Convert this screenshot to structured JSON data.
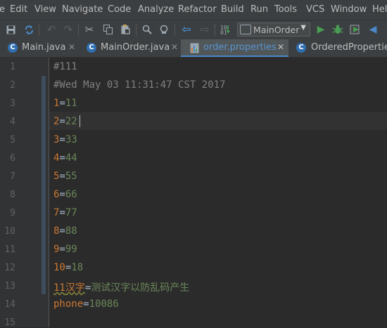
{
  "menubar": {
    "items": [
      "e",
      "Edit",
      "View",
      "Navigate",
      "Code",
      "Analyze",
      "Refactor",
      "Build",
      "Run",
      "Tools",
      "VCS",
      "Window",
      "Help"
    ]
  },
  "toolbar": {
    "run_config": "MainOrder"
  },
  "tabs": [
    {
      "label": "Main.java",
      "icon": "C",
      "active": false
    },
    {
      "label": "MainOrder.java",
      "icon": "C",
      "active": false
    },
    {
      "label": "order.properties",
      "icon": "properties-file",
      "active": true
    },
    {
      "label": "OrderedProperties",
      "icon": "C",
      "active": false
    }
  ],
  "editor": {
    "line_numbers": [
      "1",
      "2",
      "3",
      "4",
      "5",
      "6",
      "7",
      "8",
      "9",
      "10",
      "11",
      "12",
      "13",
      "14",
      "15"
    ],
    "lines": [
      {
        "comment": "#111"
      },
      {
        "comment": "#Wed May 03 11:31:47 CST 2017"
      },
      {
        "key": "1",
        "eq": "=",
        "value": "11"
      },
      {
        "key": "2",
        "eq": "=",
        "value": "22"
      },
      {
        "key": "3",
        "eq": "=",
        "value": "33"
      },
      {
        "key": "4",
        "eq": "=",
        "value": "44"
      },
      {
        "key": "5",
        "eq": "=",
        "value": "55"
      },
      {
        "key": "6",
        "eq": "=",
        "value": "66"
      },
      {
        "key": "7",
        "eq": "=",
        "value": "77"
      },
      {
        "key": "8",
        "eq": "=",
        "value": "88"
      },
      {
        "key": "9",
        "eq": "=",
        "value": "99"
      },
      {
        "key": "10",
        "eq": "=",
        "value": "18"
      },
      {
        "key_plain": "11",
        "key_warn": "汉字",
        "eq": "=",
        "value": "测试汉字以防乱码产生"
      },
      {
        "key": "phone",
        "eq": "=",
        "value": "10086"
      }
    ]
  },
  "colors": {
    "background": "#2b2b2b",
    "gutter": "#313335",
    "chrome": "#3c3f41",
    "comment": "#808080",
    "key": "#cc7832",
    "value": "#6a8759",
    "active_tab_text": "#5895d2"
  }
}
